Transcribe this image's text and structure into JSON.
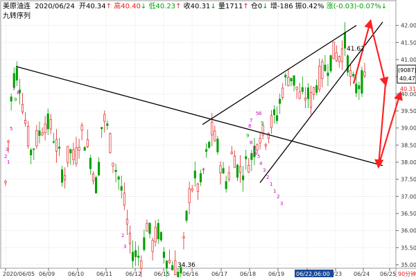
{
  "header": {
    "title": "美原油连",
    "date": "2020/06/24",
    "open": "开40.34",
    "open_arrow": "↑",
    "high": "高40.40",
    "high_arrow": "↓",
    "low": "低40.23",
    "low_arrow": "↑",
    "close": "收40.31",
    "close_arrow": "↓",
    "volume": "量1711",
    "volume_arrow": "↑",
    "position": "仓0",
    "position_arrow": "↓",
    "increase": "增-186",
    "amplitude": "振0.42%",
    "change": "涨(-0.03)-0.07%",
    "change_arrow": "↓",
    "indicator": "九转序列"
  },
  "colors": {
    "background": "#ffffff",
    "up": "#e02020",
    "down": "#00a000",
    "grid": "#c8c8c8",
    "trendline": "#000000",
    "forecast_arrow": "#ff2020",
    "td_label": "#cc00cc",
    "axis_text": "#333333",
    "date_highlight_bg": "#1a4a9a",
    "price_box_border": "#000000",
    "last_price": "#e02020"
  },
  "chart_data": {
    "type": "candlestick",
    "ylim": [
      35.0,
      42.5
    ],
    "y_ticks": [
      "42.00",
      "41.50",
      "41.00",
      "40.50",
      "40.00",
      "39.50",
      "39.00",
      "38.50",
      "38.00",
      "37.50",
      "37.00",
      "36.50",
      "36.00",
      "35.50",
      "35.00"
    ],
    "x_ticks": [
      "2020/06/05",
      "06/09",
      "06/10",
      "06/11",
      "06/12",
      "06/15",
      "06/16",
      "06/17",
      "06/18",
      "06/19",
      "06/22",
      "06/23",
      "06/24",
      "06/25"
    ],
    "timeframe": "90分钟",
    "price_box": {
      "label": "(9087)",
      "value": "40.47"
    },
    "last_price": "40.31",
    "annotations": {
      "high": "41.62",
      "low": "34.36",
      "crosshair_date": "06/22,06:00"
    },
    "td_sequence_labels": [
      "7",
      "8",
      "9",
      "5",
      "3",
      "2",
      "1",
      "2",
      "3",
      "9",
      "5",
      "6",
      "7",
      "8",
      "9",
      "8",
      "7",
      "6",
      "5",
      "4",
      "3",
      "2",
      "1",
      "1",
      "2",
      "3"
    ],
    "candles_summary": {
      "start_date": "2020/06/05",
      "end_date": "06/24",
      "drawn_lines": [
        {
          "from": [
            "2020/06/05",
            40.8
          ],
          "to": [
            "06/25",
            37.9
          ]
        },
        {
          "from": [
            "06/16",
            39.1
          ],
          "to": [
            "06/24",
            42.0
          ]
        },
        {
          "from": [
            "06/18",
            37.4
          ],
          "to": [
            "06/25",
            42.1
          ]
        }
      ],
      "forecast_path": [
        "40.3",
        "42.1",
        "40.3",
        "37.9",
        "40.0"
      ]
    }
  }
}
